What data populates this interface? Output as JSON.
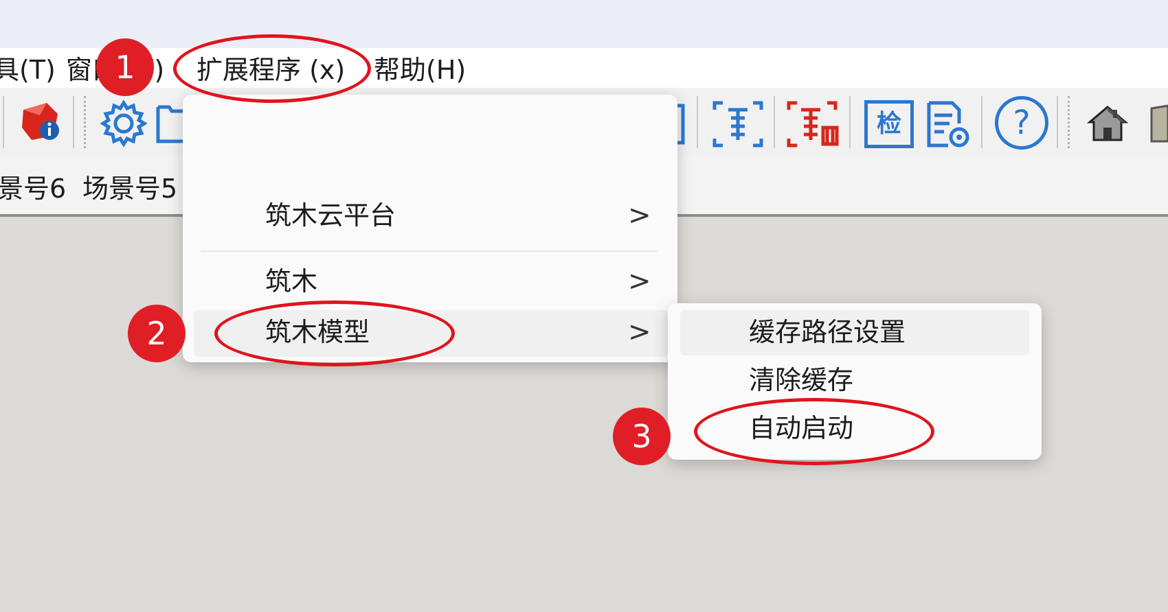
{
  "menubar": {
    "items": [
      {
        "label": "具(T)"
      },
      {
        "label": "窗口(W)"
      },
      {
        "label": "扩展程序 (x)"
      },
      {
        "label": "帮助(H)"
      }
    ]
  },
  "toolbar": {
    "icons": [
      {
        "name": "model-info-icon"
      },
      {
        "name": "gear-icon"
      },
      {
        "name": "folder-icon"
      },
      {
        "name": "frame-icon"
      },
      {
        "name": "component-blue-icon"
      },
      {
        "name": "component-red-icon"
      },
      {
        "name": "check-icon",
        "label": "检"
      },
      {
        "name": "document-settings-icon"
      },
      {
        "name": "help-icon",
        "label": "?"
      },
      {
        "name": "house-icon"
      },
      {
        "name": "box-icon"
      }
    ]
  },
  "scene_tabs": [
    {
      "label": "景号6"
    },
    {
      "label": "场景号5"
    }
  ],
  "dropdown": {
    "items": [
      {
        "label": "筑木云平台",
        "arrow": ">"
      },
      {
        "label": "筑木",
        "arrow": ">"
      },
      {
        "label": "筑木模型",
        "arrow": ">"
      }
    ]
  },
  "submenu": {
    "items": [
      {
        "label": "缓存路径设置"
      },
      {
        "label": "清除缓存"
      },
      {
        "label": "自动启动"
      }
    ]
  },
  "annotations": {
    "badges": [
      "1",
      "2",
      "3"
    ]
  },
  "colors": {
    "annotation_red": "#e0141c",
    "icon_blue": "#2a78d0",
    "icon_red": "#d8261c"
  }
}
